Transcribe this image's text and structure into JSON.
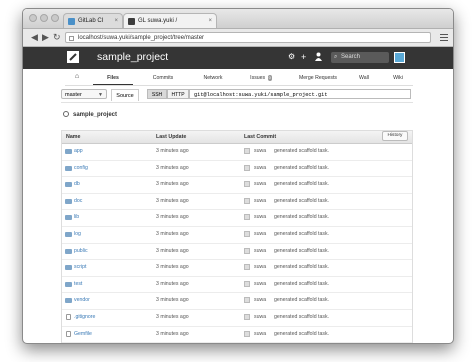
{
  "browser": {
    "tabs": [
      {
        "label": "GitLab CI",
        "favicon": "gitlab-ci-favicon",
        "favicon_color": "#4a90c8"
      },
      {
        "label": "GL suwa.yuki / sample_project | ...",
        "favicon": "gitlab-favicon",
        "favicon_color": "#3d3d3d"
      }
    ],
    "url": "localhost/suwa.yuki/sample_project/tree/master",
    "back_icon": "arrow-left-icon",
    "forward_icon": "arrow-right-icon",
    "reload_icon": "reload-icon"
  },
  "header": {
    "project_title": "sample_project",
    "icons": [
      "gear-icon",
      "plus-icon",
      "user-icon"
    ],
    "search_placeholder": "Search",
    "bg_color": "#353535"
  },
  "nav": {
    "home_icon": "home-icon",
    "items": [
      "Files",
      "Commits",
      "Network",
      "Issues",
      "Merge Requests",
      "Wall",
      "Wiki"
    ],
    "issues_count": "0",
    "active": "Files"
  },
  "toolbar": {
    "branch": "master",
    "source_label": "Source",
    "ssh_label": "SSH",
    "http_label": "HTTP",
    "clone_url": "git@localhost:suwa.yuki/sample_project.git"
  },
  "repo": {
    "name": "sample_project"
  },
  "table": {
    "headers": {
      "name": "Name",
      "last_update": "Last Update",
      "last_commit": "Last Commit",
      "history": "History"
    },
    "rows": [
      {
        "name": "app",
        "type": "folder",
        "updated": "3 minutes ago",
        "author": "suwa",
        "message": "generated scaffold task."
      },
      {
        "name": "config",
        "type": "folder",
        "updated": "3 minutes ago",
        "author": "suwa",
        "message": "generated scaffold task."
      },
      {
        "name": "db",
        "type": "folder",
        "updated": "3 minutes ago",
        "author": "suwa",
        "message": "generated scaffold task."
      },
      {
        "name": "doc",
        "type": "folder",
        "updated": "3 minutes ago",
        "author": "suwa",
        "message": "generated scaffold task."
      },
      {
        "name": "lib",
        "type": "folder",
        "updated": "3 minutes ago",
        "author": "suwa",
        "message": "generated scaffold task."
      },
      {
        "name": "log",
        "type": "folder",
        "updated": "3 minutes ago",
        "author": "suwa",
        "message": "generated scaffold task."
      },
      {
        "name": "public",
        "type": "folder",
        "updated": "3 minutes ago",
        "author": "suwa",
        "message": "generated scaffold task."
      },
      {
        "name": "script",
        "type": "folder",
        "updated": "3 minutes ago",
        "author": "suwa",
        "message": "generated scaffold task."
      },
      {
        "name": "test",
        "type": "folder",
        "updated": "3 minutes ago",
        "author": "suwa",
        "message": "generated scaffold task."
      },
      {
        "name": "vendor",
        "type": "folder",
        "updated": "3 minutes ago",
        "author": "suwa",
        "message": "generated scaffold task."
      },
      {
        "name": ".gitignore",
        "type": "file",
        "updated": "3 minutes ago",
        "author": "suwa",
        "message": "generated scaffold task."
      },
      {
        "name": "Gemfile",
        "type": "file",
        "updated": "3 minutes ago",
        "author": "suwa",
        "message": "generated scaffold task."
      }
    ]
  }
}
